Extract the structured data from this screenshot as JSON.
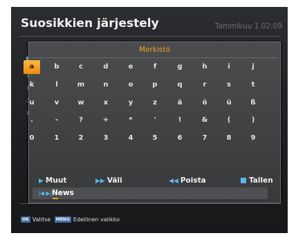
{
  "header": {
    "title": "Suosikkien järjestely",
    "datetime": "Tammikuu 1 02:09"
  },
  "background_list": {
    "letters": [
      "I",
      "I",
      "I",
      "S",
      "I"
    ]
  },
  "keyboard": {
    "title": "Merkistö",
    "selected_key": "a",
    "rows": [
      [
        "a",
        "b",
        "c",
        "d",
        "e",
        "f",
        "g",
        "h",
        "i",
        "j"
      ],
      [
        "k",
        "l",
        "m",
        "n",
        "o",
        "p",
        "q",
        "r",
        "s",
        "t"
      ],
      [
        "u",
        "v",
        "w",
        "x",
        "y",
        "z",
        "ä",
        "ö",
        "ü",
        "ß"
      ],
      [
        ".",
        "-",
        "?",
        "+",
        "*",
        "'",
        "!",
        "&",
        "(",
        ")"
      ],
      [
        "0",
        "1",
        "2",
        "3",
        "4",
        "5",
        "6",
        "7",
        "8",
        "9"
      ]
    ]
  },
  "actions": {
    "other": {
      "label": "Muut",
      "icon": "play-right-icon"
    },
    "space": {
      "label": "Väli",
      "icon": "fast-forward-icon"
    },
    "delete": {
      "label": "Poista",
      "icon": "rewind-icon"
    },
    "save": {
      "label": "Tallen",
      "icon": "stop-square-icon"
    }
  },
  "input": {
    "value": "News",
    "icon": "skip-previous-next-icon"
  },
  "legend": {
    "ok_badge": "OK",
    "ok_label": "Valitse",
    "menu_badge": "MENU",
    "menu_label": "Edellinen valikko"
  },
  "colors": {
    "accent": "#f0a020",
    "selected_key": "#ffa020",
    "icon_blue": "#5bb4ea",
    "badge_blue": "#3e6ea2"
  }
}
